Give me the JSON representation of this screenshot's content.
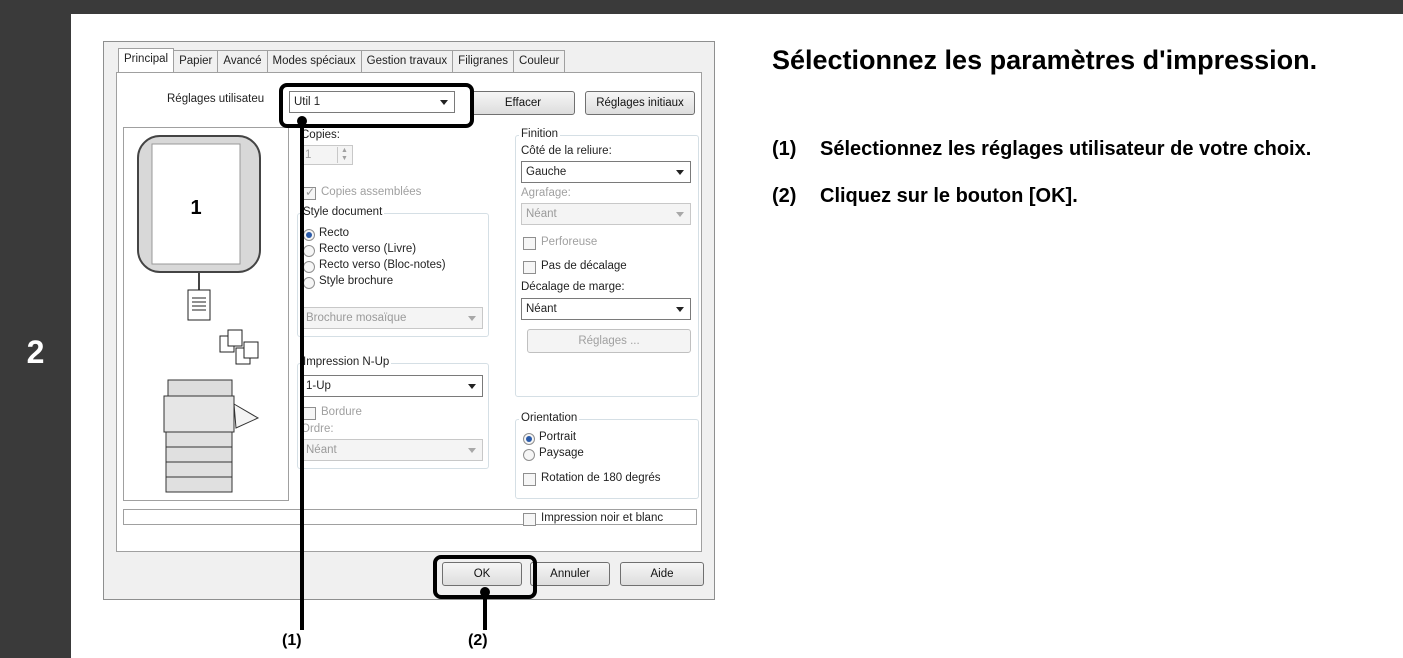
{
  "step": "2",
  "dialog": {
    "tabs": [
      "Principal",
      "Papier",
      "Avancé",
      "Modes spéciaux",
      "Gestion travaux",
      "Filigranes",
      "Couleur"
    ],
    "user_settings_label": "Réglages utilisateu",
    "user_settings_value": "Util 1",
    "clear_button": "Effacer",
    "defaults_button": "Réglages initiaux",
    "preview_page": "1",
    "copies_label": "Copies:",
    "copies_value": "1",
    "collate_label": "Copies assemblées",
    "document_style": {
      "label": "Style document",
      "options": [
        "Recto",
        "Recto verso (Livre)",
        "Recto verso (Bloc-notes)",
        "Style brochure"
      ],
      "selected": "Recto",
      "brochure_value": "Brochure mosaïque"
    },
    "nup": {
      "label": "Impression N-Up",
      "value": "1-Up",
      "border_label": "Bordure",
      "order_label": "Ordre:",
      "order_value": "Néant"
    },
    "finishing": {
      "label": "Finition",
      "binding_edge_label": "Côté de la reliure:",
      "binding_edge_value": "Gauche",
      "staple_label": "Agrafage:",
      "staple_value": "Néant",
      "punch_label": "Perforeuse",
      "no_offset_label": "Pas de décalage",
      "margin_shift_label": "Décalage de marge:",
      "margin_shift_value": "Néant",
      "settings_button": "Réglages ..."
    },
    "orientation": {
      "label": "Orientation",
      "options": [
        "Portrait",
        "Paysage"
      ],
      "selected": "Portrait",
      "rotate_label": "Rotation de 180 degrés"
    },
    "bw_label": "Impression noir et blanc",
    "ok_button": "OK",
    "cancel_button": "Annuler",
    "help_button": "Aide"
  },
  "callouts": [
    "(1)",
    "(2)"
  ],
  "instructions": {
    "heading": "Sélectionnez les paramètres d'impression.",
    "steps": [
      {
        "num": "(1)",
        "text": "Sélectionnez les réglages utilisateur de votre choix."
      },
      {
        "num": "(2)",
        "text": "Cliquez sur le bouton [OK]."
      }
    ]
  }
}
